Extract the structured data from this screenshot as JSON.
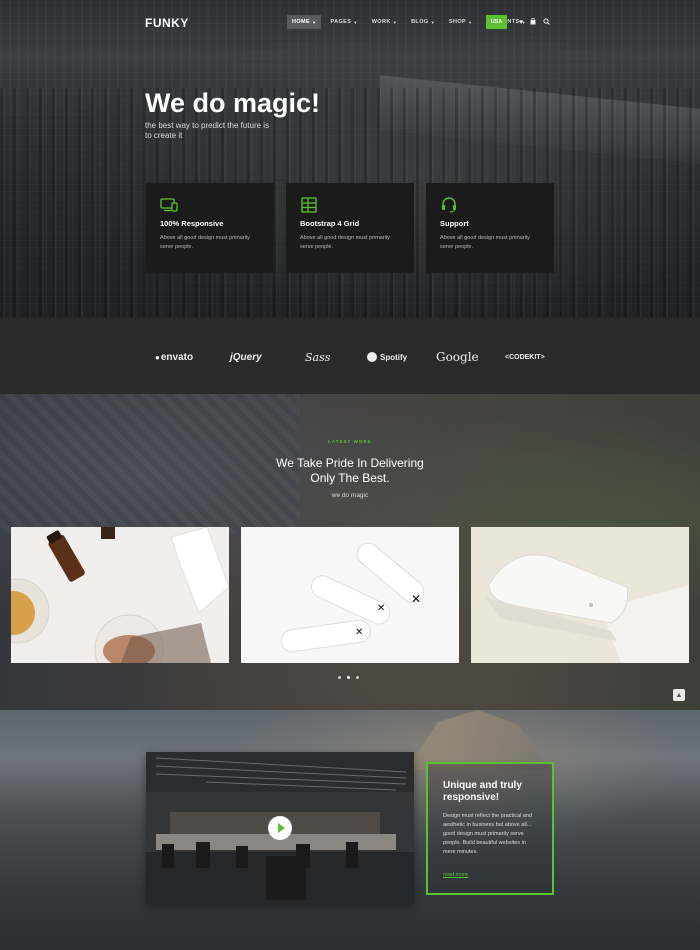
{
  "brand": "FUNKY",
  "nav": {
    "items": [
      {
        "label": "HOME",
        "active": true
      },
      {
        "label": "PAGES"
      },
      {
        "label": "WORK"
      },
      {
        "label": "BLOG"
      },
      {
        "label": "SHOP"
      },
      {
        "label": "ELEMENTS"
      }
    ],
    "language_button": "USA",
    "icons": [
      "heart-icon",
      "bag-icon",
      "search-icon"
    ]
  },
  "hero": {
    "title": "We do magic!",
    "subtitle": "the best way to predict the future is to create it"
  },
  "features": [
    {
      "icon": "devices-icon",
      "title": "100% Responsive",
      "text": "Above all good design must primarily serve people."
    },
    {
      "icon": "grid-icon",
      "title": "Bootstrap 4 Grid",
      "text": "Above all good design must primarily serve people."
    },
    {
      "icon": "headset-icon",
      "title": "Support",
      "text": "Above all good design must primarily serve people."
    }
  ],
  "partners": [
    "envato",
    "jQuery",
    "Sass",
    "Spotify",
    "Google",
    "<CODEKIT>"
  ],
  "portfolio": {
    "tag": "LATEST WORK",
    "title": "We Take Pride In Delivering Only The Best.",
    "subtitle": "we do magic",
    "slides_total": 3,
    "active_slide": 2
  },
  "promo": {
    "title": "Unique and truly responsive!",
    "text": "Design must reflect the practical and aesthetic in business but above all... good design must primarily serve people. Build beautiful websites in mere minutes.",
    "link": "read more"
  },
  "colors": {
    "accent": "#5cc130",
    "card_dark": "#1b1b1c",
    "strip": "#2a2a2a"
  }
}
